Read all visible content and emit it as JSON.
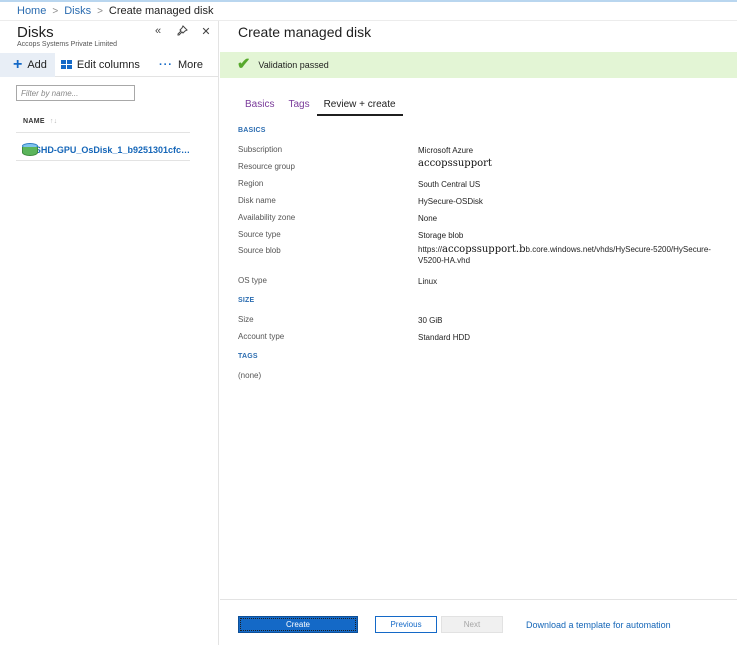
{
  "breadcrumb": {
    "items": [
      "Home",
      "Disks"
    ],
    "current": "Create managed disk",
    "separator": ">"
  },
  "left_panel": {
    "title": "Disks",
    "subtitle": "Accops Systems Private Limited",
    "controls": {
      "collapse_icon": "«",
      "pin_icon": "pin-icon",
      "close_icon": "✕"
    },
    "toolbar": {
      "add_label": "Add",
      "edit_columns_label": "Edit columns",
      "more_label": "More"
    },
    "filter": {
      "placeholder": "Filter by name...",
      "value": ""
    },
    "column_header": "NAME",
    "rows": [
      {
        "name": "SHD-GPU_OsDisk_1_b9251301cfc…",
        "icon": "disk-icon"
      }
    ]
  },
  "right_panel": {
    "title": "Create managed disk",
    "validation": {
      "text": "Validation passed",
      "status_color": "#57a82c",
      "icon": "checkmark-icon"
    },
    "tabs": [
      {
        "label": "Basics",
        "active": false
      },
      {
        "label": "Tags",
        "active": false
      },
      {
        "label": "Review + create",
        "active": true
      }
    ],
    "sections": {
      "basics": {
        "heading": "BASICS",
        "fields": [
          {
            "label": "Subscription",
            "value": "Microsoft Azure"
          },
          {
            "label": "Resource group",
            "value": "accopssupport"
          },
          {
            "label": "Region",
            "value": "South Central US"
          },
          {
            "label": "Disk name",
            "value": "HySecure-OSDisk"
          },
          {
            "label": "Availability zone",
            "value": "None"
          },
          {
            "label": "Source type",
            "value": "Storage blob"
          },
          {
            "label": "Source blob",
            "value_prefix": "https://",
            "value_emph": "accopssupport.b",
            "value_suffix": "b.core.windows.net/vhds/HySecure-5200/HySecure-V5200-HA.vhd"
          },
          {
            "label": "OS type",
            "value": "Linux"
          }
        ]
      },
      "size": {
        "heading": "SIZE",
        "fields": [
          {
            "label": "Size",
            "value": "30 GiB"
          },
          {
            "label": "Account type",
            "value": "Standard HDD"
          }
        ]
      },
      "tags": {
        "heading": "TAGS",
        "value": "(none)"
      }
    },
    "footer": {
      "create_label": "Create",
      "previous_label": "Previous",
      "next_label": "Next",
      "download_label": "Download a template for automation"
    }
  },
  "colors": {
    "accent": "#1469c7",
    "link": "#1566b8",
    "validation_bg": "#e3f5d5",
    "tab_inactive": "#7a3b9a"
  }
}
